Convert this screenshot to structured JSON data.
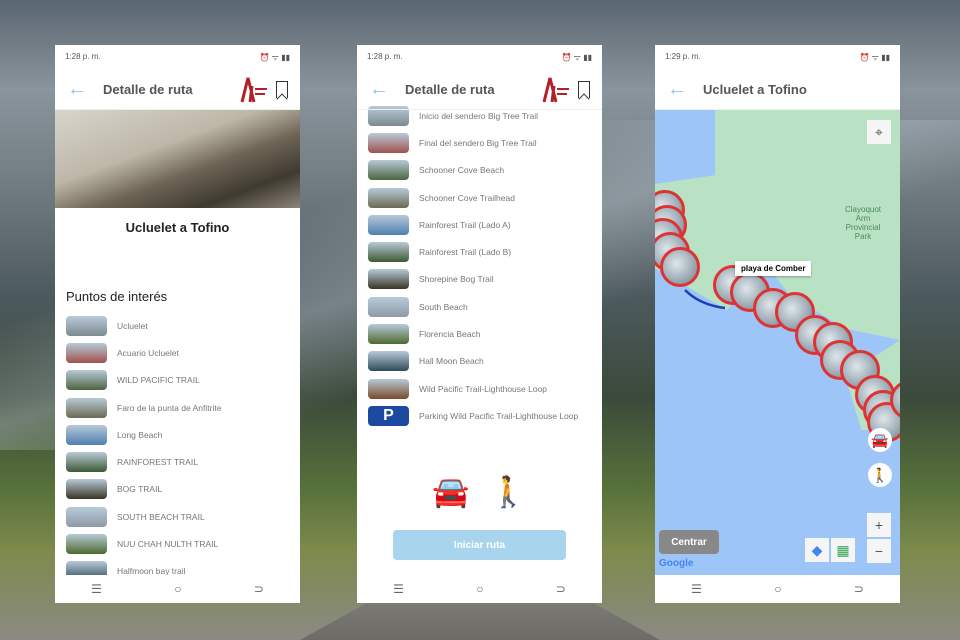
{
  "colors": {
    "accent": "#8cc6e8",
    "marker": "#d33333",
    "button": "#a9d4ee"
  },
  "screens": [
    {
      "status_time": "1:28 p. m.",
      "header_title": "Detalle de ruta",
      "route_title": "Ucluelet a Tofino",
      "section_title": "Puntos de interés",
      "items": [
        "Ucluelet",
        "Acuario Ucluelet",
        "WILD PACIFIC TRAIL",
        "Faro de la punta de Anfitrite",
        "Long Beach",
        "RAINFOREST TRAIL",
        "BOG TRAIL",
        "SOUTH BEACH TRAIL",
        "NUU CHAH NULTH TRAIL",
        "Halfmoon bay trail"
      ]
    },
    {
      "status_time": "1:28 p. m.",
      "header_title": "Detalle de ruta",
      "items": [
        "Inicio del sendero Big Tree Trail",
        "Final del sendero Big Tree Trail",
        "Schooner Cove Beach",
        "Schooner Cove Trailhead",
        "Rainforest Trail (Lado A)",
        "Rainforest Trail (Lado B)",
        "Shorepine Bog Trail",
        "South Beach",
        "Florencia Beach",
        "Hall Moon Beach",
        "Wild Pacific Trail-Lighthouse Loop",
        "Parking Wild Pacific Trail-Lighthouse Loop"
      ],
      "modes": [
        "car-icon",
        "walk-icon"
      ],
      "start_label": "Iniciar ruta"
    },
    {
      "status_time": "1:29 p. m.",
      "header_title": "Ucluelet a Tofino",
      "tooltip": "playa de Comber",
      "park_label": "Clayoquot Arm Provincial Park",
      "centrar_label": "Centrar",
      "google_label": "Google"
    }
  ],
  "navbar": [
    "☰",
    "○",
    "⊃"
  ]
}
